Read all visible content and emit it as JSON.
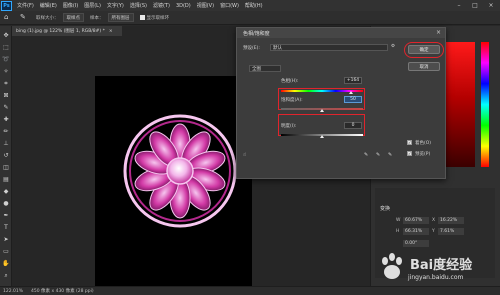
{
  "app": {
    "logo": "Ps"
  },
  "menu": [
    "文件(F)",
    "编辑(E)",
    "图像(I)",
    "图层(L)",
    "文字(Y)",
    "选择(S)",
    "滤镜(T)",
    "3D(D)",
    "视图(V)",
    "窗口(W)",
    "帮助(H)"
  ],
  "options_bar": {
    "sample_size": "取样大小：",
    "sample_value": "取样点",
    "sample": "样本：",
    "sample_target": "所有图层",
    "show_ring": "显示取样环"
  },
  "document_tab": {
    "title": "bing (1).jpg @ 122% (图层 1, RGB/8#) *"
  },
  "dialog": {
    "title": "色相/饱和度",
    "preset_label": "预设(E):",
    "preset_value": "默认",
    "channel_value": "全图",
    "hue_label": "色相(H):",
    "hue_value": "+164",
    "saturation_label": "饱和度(A):",
    "saturation_value": "50",
    "lightness_label": "明度(I):",
    "lightness_value": "0",
    "ok_label": "确定",
    "cancel_label": "取消",
    "colorize_label": "着色(O)",
    "preview_label": "预览(P)",
    "colorize_checked": true,
    "preview_checked": true
  },
  "properties": {
    "title": "变换",
    "w_label": "W",
    "w_value": "60.67%",
    "h_label": "H",
    "h_value": "66.31%",
    "x_label": "X",
    "x_value": "16.22%",
    "y_label": "Y",
    "y_value": "7.61%",
    "angle_value": "0.00°"
  },
  "status": {
    "zoom": "122.01%",
    "size": "450 像素 x 430 像素 (28 ppi)"
  },
  "watermark": {
    "main": "Bai度经验",
    "sub": "jingyan.baidu.com"
  },
  "colors": {
    "accent_red": "#e0242c",
    "magenta": "#d23aa6",
    "pink_light": "#f3b6ea"
  }
}
